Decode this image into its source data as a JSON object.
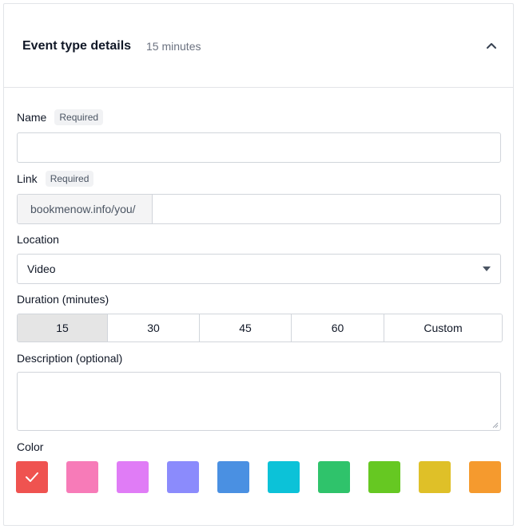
{
  "header": {
    "title": "Event type details",
    "subtitle": "15 minutes"
  },
  "name_field": {
    "label": "Name",
    "badge": "Required",
    "value": ""
  },
  "link_field": {
    "label": "Link",
    "badge": "Required",
    "prefix": "bookmenow.info/you/",
    "value": ""
  },
  "location_field": {
    "label": "Location",
    "value": "Video"
  },
  "duration_field": {
    "label": "Duration (minutes)",
    "options": [
      "15",
      "30",
      "45",
      "60",
      "Custom"
    ],
    "selected": "15"
  },
  "description_field": {
    "label": "Description (optional)",
    "value": ""
  },
  "color_field": {
    "label": "Color",
    "swatches": [
      {
        "name": "red",
        "hex": "#ef5350",
        "selected": true
      },
      {
        "name": "pink",
        "hex": "#f77bb8"
      },
      {
        "name": "magenta",
        "hex": "#e07cf6"
      },
      {
        "name": "lavender",
        "hex": "#8b8bfc"
      },
      {
        "name": "blue",
        "hex": "#4a90e2"
      },
      {
        "name": "cyan",
        "hex": "#0cc2d8"
      },
      {
        "name": "green",
        "hex": "#2fc36b"
      },
      {
        "name": "lime",
        "hex": "#66c822"
      },
      {
        "name": "yellow",
        "hex": "#dfc028"
      },
      {
        "name": "orange",
        "hex": "#f59a2e"
      }
    ]
  }
}
